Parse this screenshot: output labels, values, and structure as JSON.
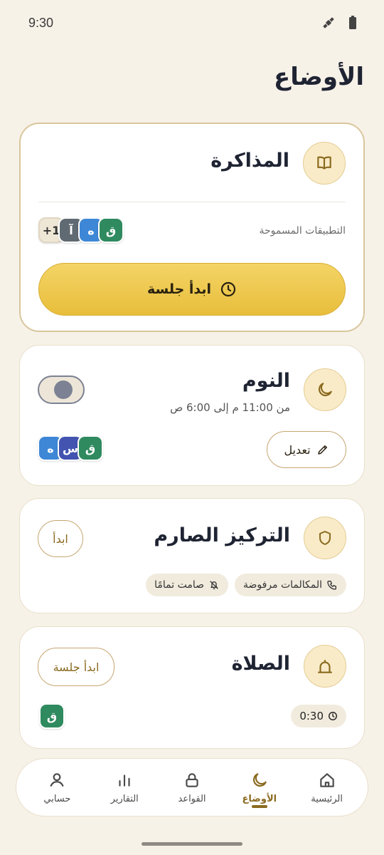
{
  "status_bar": {
    "time": "9:30",
    "icons": [
      "satellite-icon",
      "battery-icon"
    ]
  },
  "page": {
    "title": "الأوضاع"
  },
  "colors": {
    "accent": "#8A6A1E",
    "gold_button": "#F0C94A",
    "background": "#F7F2E8"
  },
  "modes": {
    "study": {
      "title": "المذاكرة",
      "icon": "book-icon",
      "allowed_label": "التطبيقات المسموحة",
      "apps": [
        {
          "letter": "+1",
          "color": "#EFE7D6"
        },
        {
          "letter": "آ",
          "color": "#606A72"
        },
        {
          "letter": "ه",
          "color": "#3E87D6"
        },
        {
          "letter": "ق",
          "color": "#2F8A5F"
        }
      ],
      "start_label": "ابدأ جلسة"
    },
    "sleep": {
      "title": "النوم",
      "icon": "moon-icon",
      "schedule": "من 11:00 م إلى 6:00 ص",
      "edit_label": "تعديل",
      "enabled": false,
      "apps": [
        {
          "letter": "ه",
          "color": "#3E87D6"
        },
        {
          "letter": "س",
          "color": "#4254B0"
        },
        {
          "letter": "ق",
          "color": "#2F8A5F"
        }
      ]
    },
    "strict_focus": {
      "title": "التركيز الصارم",
      "icon": "shield-icon",
      "start_label": "ابدأ",
      "tags": [
        {
          "label": "المكالمات مرفوضة",
          "icon": "phone-icon"
        },
        {
          "label": "صامت تمامًا",
          "icon": "bell-off-icon"
        }
      ]
    },
    "prayer": {
      "title": "الصلاة",
      "icon": "mosque-icon",
      "start_label": "ابدأ جلسة",
      "duration": "0:30",
      "apps": [
        {
          "letter": "ق",
          "color": "#2F8A5F"
        }
      ]
    }
  },
  "nav": {
    "items": [
      {
        "label": "الرئيسية",
        "icon": "home-icon"
      },
      {
        "label": "الأوضاع",
        "icon": "moon-icon",
        "active": true
      },
      {
        "label": "القواعد",
        "icon": "lock-icon"
      },
      {
        "label": "التقارير",
        "icon": "bar-chart-icon"
      },
      {
        "label": "حسابي",
        "icon": "user-icon"
      }
    ]
  }
}
